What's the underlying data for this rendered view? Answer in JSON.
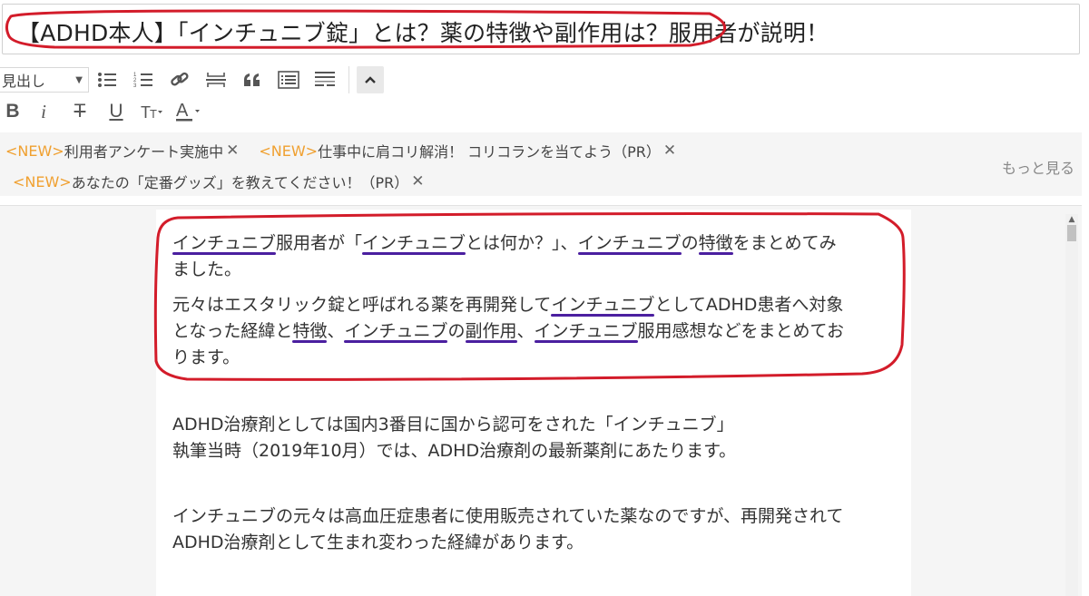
{
  "title": {
    "value": "【ADHD本人】「インチュニブ錠」とは？薬の特徴や副作用は？服用者が説明！"
  },
  "toolbar": {
    "heading_select": "見出し",
    "icons": [
      "bullet-list-icon",
      "numbered-list-icon",
      "link-icon",
      "horizontal-rule-icon",
      "quote-icon",
      "table-of-contents-icon",
      "read-more-icon",
      "collapse-icon"
    ],
    "format": {
      "bold": "B",
      "italic": "i",
      "strike": "T",
      "underline": "U"
    }
  },
  "notices": {
    "new_tag": "<NEW>",
    "items": [
      "利用者アンケート実施中",
      "仕事中に肩コリ解消！ コリコランを当てよう（PR）",
      "あなたの「定番グッズ」を教えてください！（PR）"
    ],
    "close_symbol": "✕",
    "more": "もっと見る"
  },
  "body": {
    "p1": [
      {
        "t": "インチュニブ",
        "u": true
      },
      {
        "t": "服用者が「",
        "u": false
      },
      {
        "t": "インチュニブ",
        "u": true
      },
      {
        "t": "とは何か？」、",
        "u": false
      },
      {
        "t": "インチュニブ",
        "u": true
      },
      {
        "t": "の",
        "u": false
      },
      {
        "t": "特徴",
        "u": true
      },
      {
        "t": "をまとめてみ",
        "u": false
      },
      {
        "br": true
      },
      {
        "t": "ました。",
        "u": false
      }
    ],
    "p2": [
      {
        "t": "元々はエスタリック錠と呼ばれる薬を再開発して",
        "u": false
      },
      {
        "t": "インチュニブ",
        "u": true
      },
      {
        "t": "としてADHD患者へ対象",
        "u": false
      },
      {
        "br": true
      },
      {
        "t": "となった経緯と",
        "u": false
      },
      {
        "t": "特徴",
        "u": true
      },
      {
        "t": "、",
        "u": false
      },
      {
        "t": "インチュニブ",
        "u": true
      },
      {
        "t": "の",
        "u": false
      },
      {
        "t": "副作用",
        "u": true
      },
      {
        "t": "、",
        "u": false
      },
      {
        "t": "インチュニブ",
        "u": true
      },
      {
        "t": "服用感想などをまとめてお",
        "u": false
      },
      {
        "br": true
      },
      {
        "t": "ります。",
        "u": false
      }
    ],
    "p3_line1": "ADHD治療剤としては国内3番目に国から認可をされた「インチュニブ」",
    "p3_line2": "執筆当時（2019年10月）では、ADHD治療剤の最新薬剤にあたります。",
    "p4_line1": "インチュニブの元々は高血圧症患者に使用販売されていた薬なのですが、再開発されて",
    "p4_line2": "ADHD治療剤として生まれ変わった経緯があります。"
  },
  "colors": {
    "annotation_red": "#d31c2a",
    "underline_purple": "#4b1fa0",
    "new_tag_orange": "#f0a030"
  }
}
